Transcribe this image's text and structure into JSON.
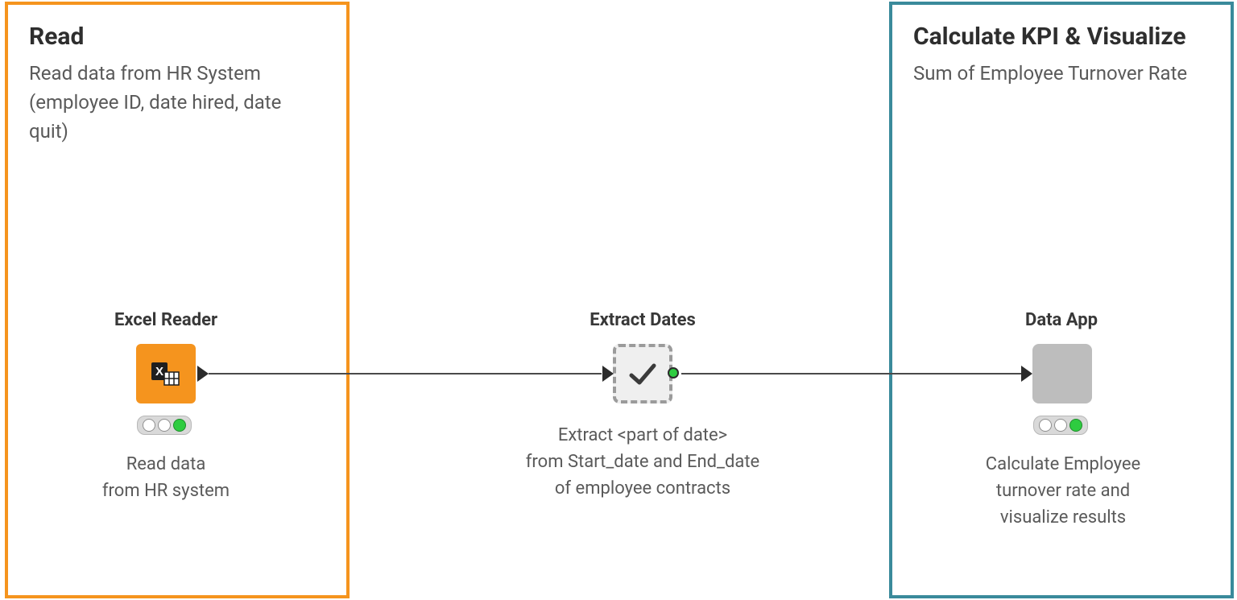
{
  "annotations": {
    "read": {
      "title": "Read",
      "description": "Read data from HR System (employee ID, date hired, date quit)"
    },
    "calc": {
      "title": "Calculate KPI & Visualize",
      "description": "Sum of Employee Turnover Rate"
    }
  },
  "nodes": {
    "excelReader": {
      "label": "Excel Reader",
      "description_line1": "Read data",
      "description_line2": "from HR system",
      "status": [
        "idle",
        "idle",
        "executed"
      ]
    },
    "extractDates": {
      "label": "Extract Dates",
      "description_line1": "Extract <part of date>",
      "description_line2": "from Start_date and End_date",
      "description_line3": "of employee contracts"
    },
    "dataApp": {
      "label": "Data App",
      "description_line1": "Calculate Employee",
      "description_line2": "turnover rate and",
      "description_line3": "visualize results",
      "status": [
        "idle",
        "idle",
        "executed"
      ]
    }
  }
}
